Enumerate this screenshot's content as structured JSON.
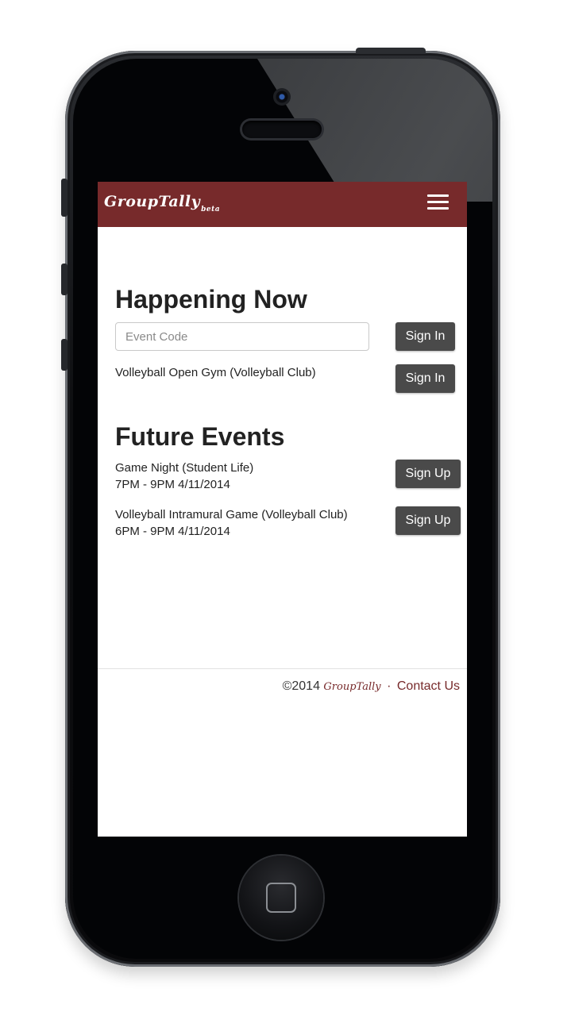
{
  "navbar": {
    "brand": "GroupTally",
    "brand_suffix": "beta",
    "menu_icon": "hamburger-menu-icon",
    "color": "#772a2b"
  },
  "happening_now": {
    "title": "Happening Now",
    "event_code_placeholder": "Event Code",
    "event_code_value": "",
    "code_sign_in_label": "Sign In",
    "events": [
      {
        "name": "Volleyball Open Gym (Volleyball Club)",
        "button_label": "Sign In"
      }
    ]
  },
  "future_events": {
    "title": "Future Events",
    "events": [
      {
        "name": "Game Night (Student Life)",
        "time": "7PM - 9PM 4/11/2014",
        "button_label": "Sign Up"
      },
      {
        "name": "Volleyball Intramural Game (Volleyball Club)",
        "time": "6PM - 9PM 4/11/2014",
        "button_label": "Sign Up"
      }
    ]
  },
  "footer": {
    "copyright": "©2014",
    "brand": "GroupTally",
    "separator": "·",
    "contact_label": "Contact Us"
  },
  "colors": {
    "accent": "#772a2b",
    "button": "#4a4a4a"
  }
}
